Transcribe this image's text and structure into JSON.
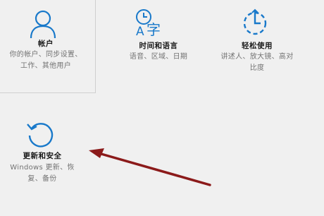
{
  "tiles": {
    "accounts": {
      "icon": "person-icon",
      "title": "帐户",
      "desc": [
        "你的帐户、同步设置、",
        "工作、其他用户"
      ]
    },
    "time_language": {
      "icon": "time-language-icon",
      "title": "时间和语言",
      "desc": [
        "语音、区域、日期"
      ]
    },
    "ease_of_access": {
      "icon": "ease-of-access-icon",
      "title": "轻松使用",
      "desc": [
        "讲述人、放大镜、高对",
        "比度"
      ]
    },
    "update_security": {
      "icon": "update-sync-icon",
      "title": "更新和安全",
      "desc": [
        "Windows 更新、恢",
        "复、备份"
      ]
    }
  },
  "colors": {
    "accent": "#1979ca",
    "annotation_arrow": "#8b1a1a"
  }
}
